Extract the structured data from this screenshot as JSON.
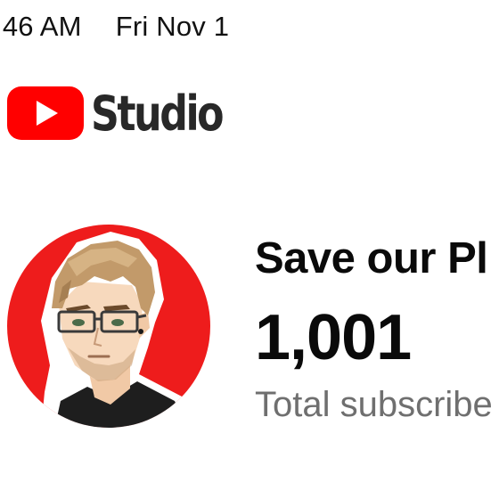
{
  "status_bar": {
    "time": ":46 AM",
    "date": "Fri Nov 1"
  },
  "app": {
    "logo_icon": "youtube-play-icon",
    "logo_word": "Studio",
    "brand_color": "#ff0000"
  },
  "channel": {
    "name": "Save our Pl",
    "subscriber_count": "1,001",
    "subscriber_label": "Total subscribe",
    "avatar_icon": "cartoon-man-with-glasses-avatar"
  }
}
